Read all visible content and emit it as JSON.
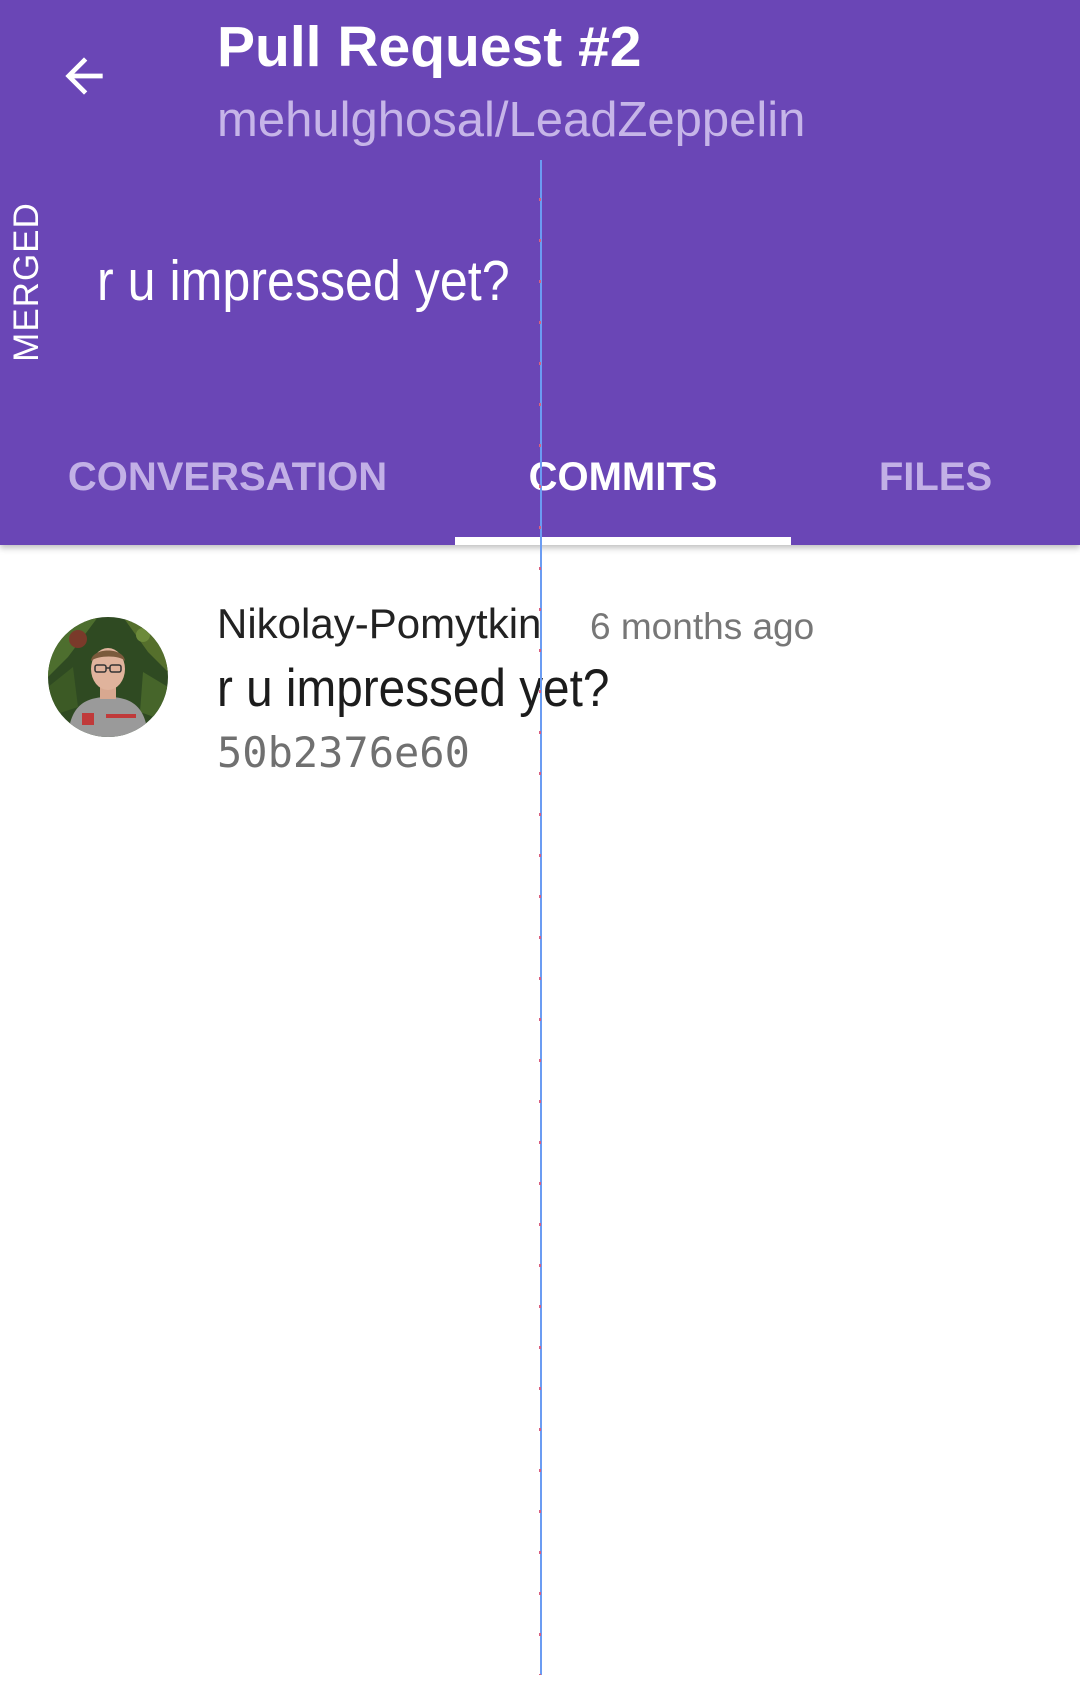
{
  "header": {
    "title": "Pull Request #2",
    "repo": "mehulghosal/LeadZeppelin",
    "status_badge": "MERGED",
    "pr_body": "r u impressed yet?",
    "back_icon": "arrow-left-icon",
    "background_color": "#6a46b6"
  },
  "tabs": [
    {
      "label": "CONVERSATION",
      "active": false
    },
    {
      "label": "COMMITS",
      "active": true
    },
    {
      "label": "FILES",
      "active": false
    }
  ],
  "commits": [
    {
      "author": "Nikolay-Pomytkin",
      "time": "6 months ago",
      "message": "r u impressed yet?",
      "sha": "50b2376e60",
      "avatar_icon": "user-avatar"
    }
  ]
}
